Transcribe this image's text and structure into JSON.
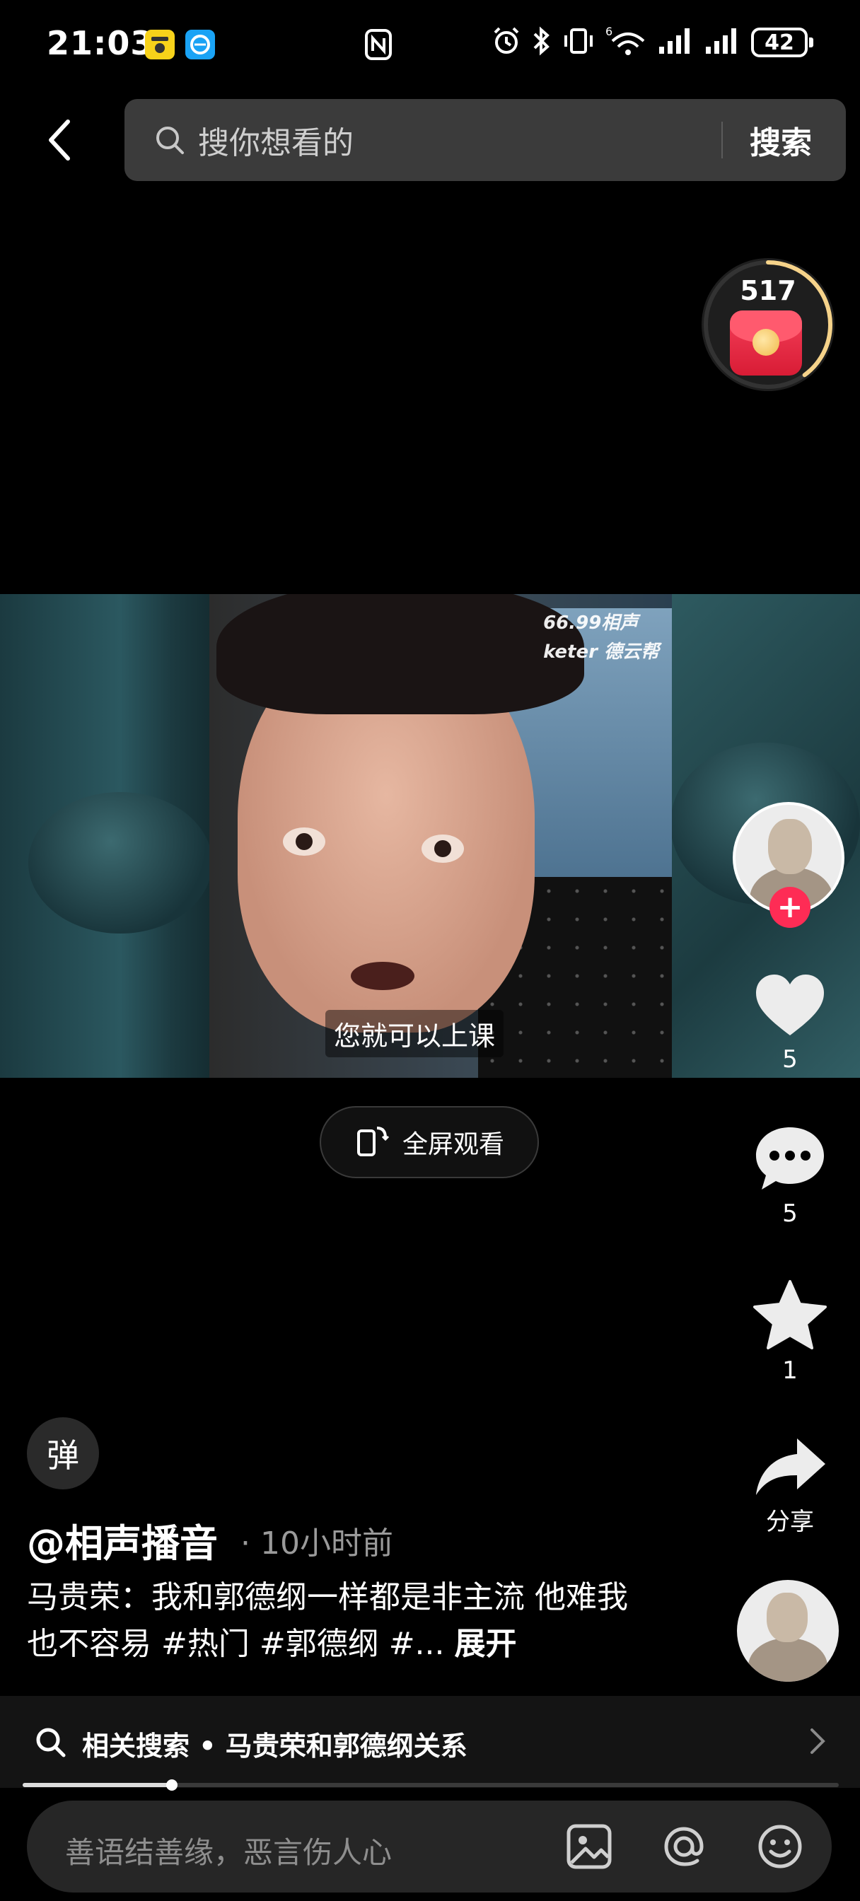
{
  "status_bar": {
    "time": "21:03",
    "network": "6",
    "battery": "42"
  },
  "search": {
    "placeholder": "搜你想看的",
    "button": "搜索"
  },
  "red_packet": {
    "count": "517",
    "progress": 0.4
  },
  "video": {
    "watermark_line1": "66.99相声",
    "watermark_line2": "keter 德云帮",
    "subtitle": "您就可以上课",
    "fullscreen_label": "全屏观看",
    "progress": 0.183
  },
  "actions": {
    "like_count": "5",
    "comment_count": "5",
    "favorite_count": "1",
    "share_label": "分享",
    "follow_symbol": "+"
  },
  "danmaku_label": "弹",
  "post": {
    "author": "@相声播音",
    "time": "· 10小时前",
    "description": "马贵荣：我和郭德纲一样都是非主流 他难我也不容易 #热门 #郭德纲 #...",
    "expand": "展开"
  },
  "related_search": {
    "text": "相关搜索 • 马贵荣和郭德纲关系"
  },
  "comment_bar": {
    "placeholder": "善语结善缘，恶言伤人心"
  },
  "colors": {
    "accent_red": "#fe2c55",
    "background": "#000000"
  },
  "icons": [
    "back-icon",
    "search-icon",
    "heart-icon",
    "comment-icon",
    "star-icon",
    "share-icon",
    "image-icon",
    "at-icon",
    "emoji-icon",
    "fullscreen-icon",
    "chevron-right-icon"
  ]
}
